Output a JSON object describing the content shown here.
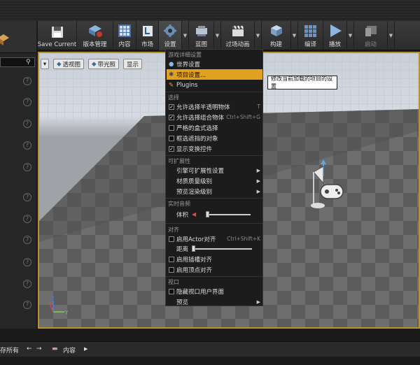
{
  "toolbar": {
    "buttons": [
      {
        "label": "Save Current",
        "icon": "floppy-disk-icon"
      },
      {
        "label": "版本管理",
        "icon": "source-control-icon"
      },
      {
        "label": "内容",
        "icon": "content-browser-icon"
      },
      {
        "label": "市场",
        "icon": "marketplace-icon"
      },
      {
        "label": "设置",
        "icon": "settings-gear-icon"
      },
      {
        "label": "蓝图",
        "icon": "blueprint-icon"
      },
      {
        "label": "过场动画",
        "icon": "clapper-icon"
      },
      {
        "label": "构建",
        "icon": "build-cubes-icon"
      },
      {
        "label": "编译",
        "icon": "compile-icon"
      },
      {
        "label": "播放",
        "icon": "play-icon"
      },
      {
        "label": "启动",
        "icon": "launch-icon"
      }
    ]
  },
  "viewport": {
    "perspective_label": "透视图",
    "lighting_label": "带光照",
    "show_label": "显示"
  },
  "menu": {
    "section_game": "游戏详细设置",
    "world_settings": "世界设置",
    "project_settings": "项目设置...",
    "plugins": "Plugins",
    "section_select": "选择",
    "allow_translucent": "允许选择半透明物体",
    "allow_translucent_shortcut": "T",
    "allow_group": "允许选择组合物体",
    "allow_group_shortcut": "Ctrl+Shift+G",
    "strict_box": "严格的盒式选择",
    "box_occluded": "框选遮挡的对象",
    "show_transform": "显示变换控件",
    "section_scalability": "可扩展性",
    "engine_scalability": "引擎可扩展性设置",
    "material_quality": "材质质量级别",
    "preview_rendering": "预览渲染级别",
    "section_audio": "实时音频",
    "volume": "体积",
    "section_snap": "对齐",
    "enable_actor_snap": "启用Actor对齐",
    "enable_actor_snap_shortcut": "Ctrl+Shift+K",
    "distance": "距离",
    "enable_socket_snap": "启用插槽对齐",
    "enable_vertex_snap": "启用顶点对齐",
    "section_viewport": "视口",
    "hide_viewport_ui": "隐藏视口用户界面",
    "previews": "预览"
  },
  "tooltip": {
    "text": "修改当前加载的项目的设置"
  },
  "bottombar": {
    "left_text": "存所有",
    "breadcrumb": "内容"
  },
  "checkboxes": {
    "allow_translucent": true,
    "allow_group": true,
    "strict_box": false,
    "box_occluded": false,
    "show_transform": true,
    "enable_actor_snap": false,
    "enable_socket_snap": false,
    "enable_vertex_snap": false,
    "hide_viewport_ui": false
  },
  "colors": {
    "highlight": "#e2a021",
    "viewport_border": "#b8932c"
  }
}
